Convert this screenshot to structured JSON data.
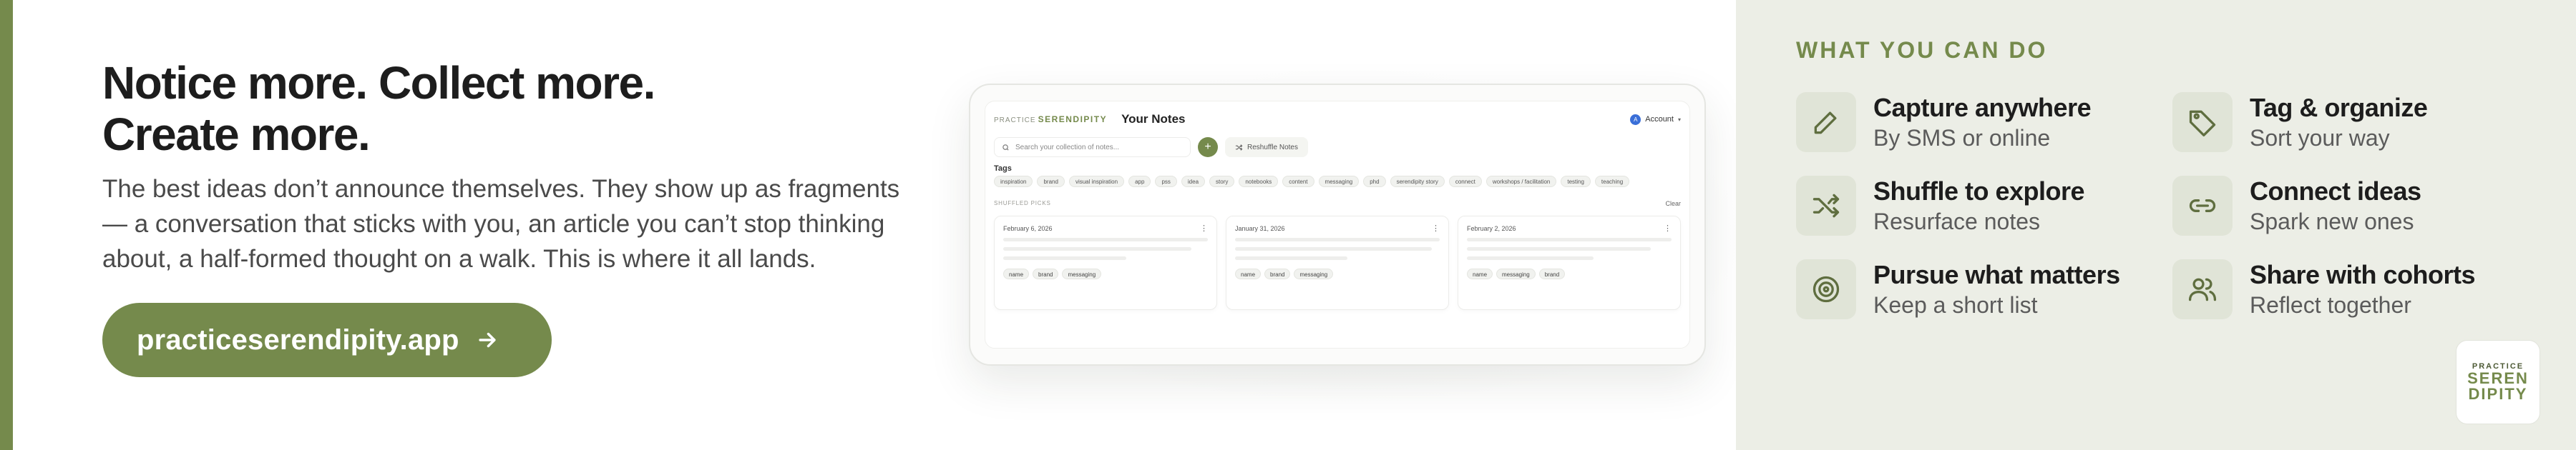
{
  "hero": {
    "headline_line1": "Notice more. Collect more.",
    "headline_line2": "Create more.",
    "lede": "The best ideas don’t announce themselves. They show up as fragments — a conversation that sticks with you, an article you can’t stop thinking about, a half-formed thought on a walk. This is where it all lands.",
    "cta_label": "practiceserendipity.app",
    "cta_icon": "arrow-right-icon"
  },
  "mockup": {
    "brand_prefix": "PRACTICE",
    "brand_name": "SERENDIPITY",
    "title": "Your Notes",
    "account_label": "Account",
    "account_initial": "A",
    "search_placeholder": "Search your collection of notes...",
    "add_label": "+",
    "reshuffle_label": "Reshuffle Notes",
    "tags_label": "Tags",
    "tags": [
      "inspiration",
      "brand",
      "visual inspiration",
      "app",
      "pss",
      "idea",
      "story",
      "notebooks",
      "content",
      "messaging",
      "phd",
      "serendipity story",
      "connect",
      "workshops / facilitation",
      "testing",
      "teaching"
    ],
    "shuffled_label": "SHUFFLED PICKS",
    "clear_label": "Clear",
    "cards": [
      {
        "date": "February 6, 2026",
        "chips": [
          "name",
          "brand",
          "messaging"
        ]
      },
      {
        "date": "January 31, 2026",
        "chips": [
          "name",
          "brand",
          "messaging"
        ]
      },
      {
        "date": "February 2, 2026",
        "chips": [
          "name",
          "messaging",
          "brand"
        ]
      }
    ]
  },
  "panel": {
    "title": "WHAT YOU CAN DO",
    "features": [
      {
        "title": "Capture anywhere",
        "subtitle": "By SMS or online",
        "icon": "pencil-icon"
      },
      {
        "title": "Tag & organize",
        "subtitle": "Sort your way",
        "icon": "tag-icon"
      },
      {
        "title": "Shuffle to explore",
        "subtitle": "Resurface notes",
        "icon": "shuffle-icon"
      },
      {
        "title": "Connect ideas",
        "subtitle": "Spark new ones",
        "icon": "link-icon"
      },
      {
        "title": "Pursue what matters",
        "subtitle": "Keep a short list",
        "icon": "target-icon"
      },
      {
        "title": "Share with cohorts",
        "subtitle": "Reflect together",
        "icon": "users-icon"
      }
    ]
  },
  "logo": {
    "top": "PRACTICE",
    "line1": "SEREN",
    "line2": "DIPITY"
  },
  "colors": {
    "accent": "#758a4c",
    "panel_bg": "#eceee6",
    "icon_bg": "#e0e4d7"
  }
}
